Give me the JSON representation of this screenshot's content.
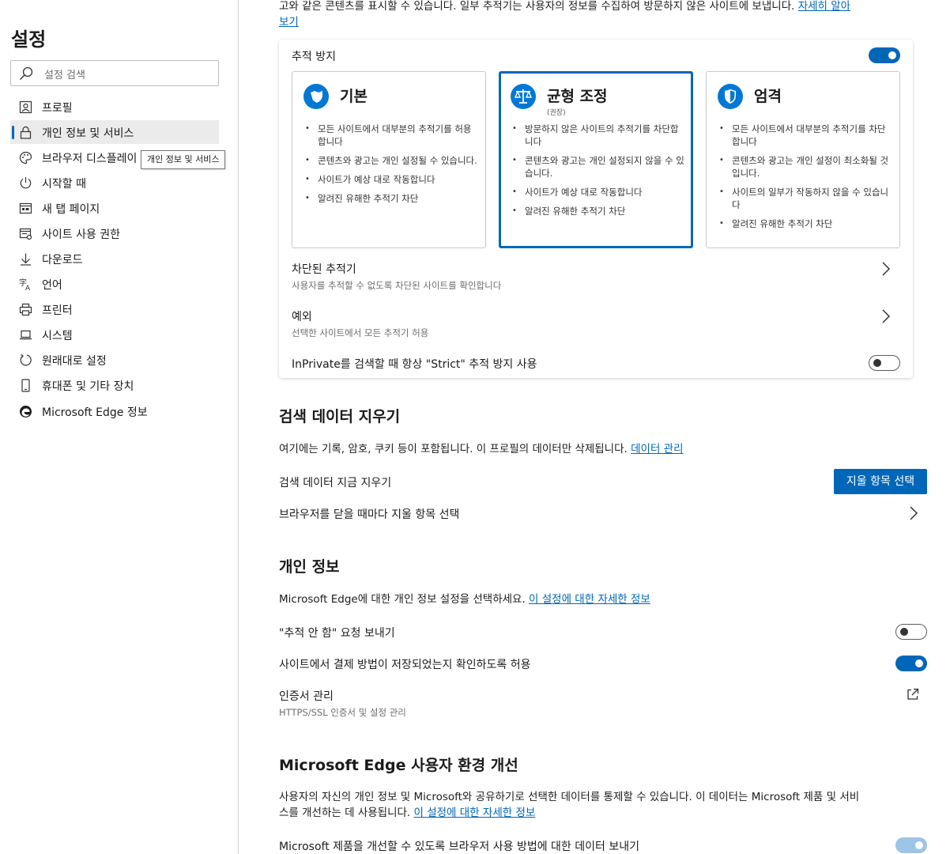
{
  "sidebar": {
    "title": "설정",
    "search_placeholder": "설정 검색",
    "items": [
      {
        "label": "프로필"
      },
      {
        "label": "개인 정보 및 서비스"
      },
      {
        "label": "브라우저 디스플레이"
      },
      {
        "label": "시작할 때"
      },
      {
        "label": "새 탭 페이지"
      },
      {
        "label": "사이트 사용 권한"
      },
      {
        "label": "다운로드"
      },
      {
        "label": "언어"
      },
      {
        "label": "프린터"
      },
      {
        "label": "시스템"
      },
      {
        "label": "원래대로 설정"
      },
      {
        "label": "휴대폰 및 기타 장치"
      },
      {
        "label": "Microsoft Edge 정보"
      }
    ],
    "tooltip": "개인 정보 및 서비스"
  },
  "top_text": {
    "line1": "고와 같은 콘텐츠를 표시할 수 있습니다. 일부 추적기는 사용자의 정보를 수집하여 방문하지 않은 사이트에 보냅니다. ",
    "link_part1": "자세히 알아",
    "link_part2": "보기"
  },
  "tracking": {
    "title": "추적 방지",
    "options": [
      {
        "name": "기본",
        "sub": "",
        "bullets": [
          "모든 사이트에서 대부분의 추적기를 허용합니다",
          "콘텐츠와 광고는 개인 설정될 수 있습니다.",
          "사이트가 예상 대로 작동합니다",
          "알려진 유해한 추적기 차단"
        ]
      },
      {
        "name": "균형 조정",
        "sub": "(권장)",
        "bullets": [
          "방문하지 않은 사이트의 추적기를 차단합니다",
          "콘텐츠와 광고는 개인 설정되지 않을 수 있습니다.",
          "사이트가 예상 대로 작동합니다",
          "알려진 유해한 추적기 차단"
        ]
      },
      {
        "name": "엄격",
        "sub": "",
        "bullets": [
          "모든 사이트에서 대부분의 추적기를 차단합니다",
          "콘텐츠와 광고는 개인 설정이 최소화될 것입니다.",
          "사이트의 일부가 작동하지 않을 수 있습니다",
          "알려진 유해한 추적기 차단"
        ]
      }
    ],
    "blocked_title": "차단된 추적기",
    "blocked_sub": "사용자를 추적할 수 없도록 차단된 사이트를 확인합니다",
    "exceptions_title": "예외",
    "exceptions_sub": "선택한 사이트에서 모든 추적기 허용",
    "inprivate": "InPrivate를 검색할 때 항상 \"Strict\" 추적 방지 사용"
  },
  "clear_data": {
    "heading": "검색 데이터 지우기",
    "desc": "여기에는 기록, 암호, 쿠키 등이 포함됩니다. 이 프로필의 데이터만 삭제됩니다. ",
    "desc_link": "데이터 관리",
    "now_label": "검색 데이터 지금 지우기",
    "button": "지울 항목 선택",
    "on_close": "브라우저를 닫을 때마다 지울 항목 선택"
  },
  "privacy": {
    "heading": "개인 정보",
    "desc": "Microsoft Edge에 대한 개인 정보 설정을 선택하세요. ",
    "desc_link": "이 설정에 대한 자세한 정보",
    "dnt": "\"추적 안 함\" 요청 보내기",
    "payment": "사이트에서 결제 방법이 저장되었는지 확인하도록 허용",
    "cert_title": "인증서 관리",
    "cert_sub": "HTTPS/SSL 인증서 및 설정 관리"
  },
  "improve": {
    "heading": "Microsoft Edge 사용자 환경 개선",
    "desc_line1": "사용자의 자신의 개인 정보 및 Microsoft와 공유하기로 선택한 데이터를 통제할 수 있습니다. 이 데이터는 Microsoft 제품 및 서비",
    "desc_line2": "스를 개선하는 데 사용됩니다. ",
    "desc_link": "이 설정에 대한 자세한 정보",
    "usage": "Microsoft 제품을 개선할 수 있도록 브라우저 사용 방법에 대한 데이터 보내기"
  },
  "colors": {
    "accent": "#0067b8"
  }
}
